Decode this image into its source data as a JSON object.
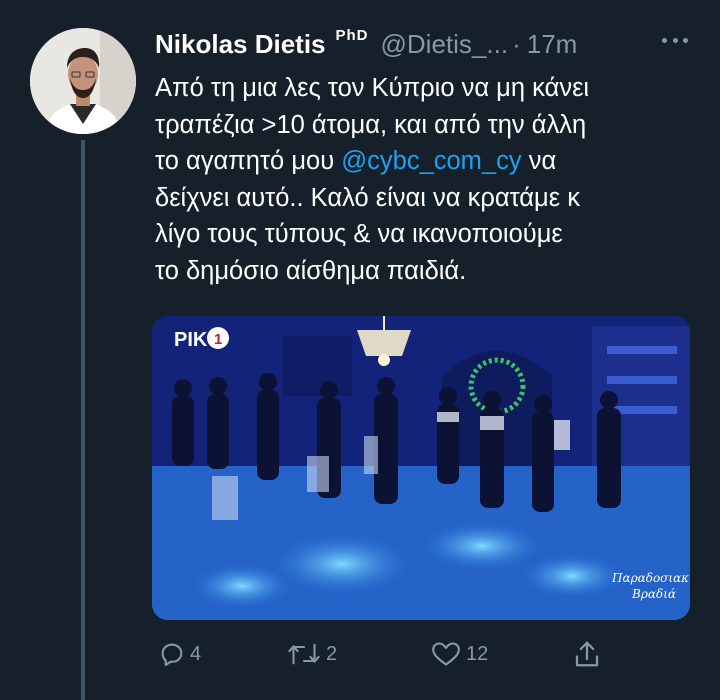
{
  "author": {
    "display_name": "Nikolas Dietis",
    "badge": "PhD",
    "handle": "@Dietis_...",
    "separator": "·",
    "time": "17m"
  },
  "tweet": {
    "lines": [
      "Από τη μια λες τον Κύπριο να μη κάνει",
      "τραπέζια >10 άτομα, και από την άλλη",
      "το αγαπητό μου",
      "δείχνει αυτό.. Καλό είναι να κρατάμε κ",
      "λίγο τους τύπους & να ικανοποιούμε",
      "το δημόσιο αίσθημα παιδιά."
    ],
    "mention": "@cybc_com_cy",
    "after_mention": "να"
  },
  "media": {
    "channel_logo": "ΡΙΚ",
    "channel_logo_digit": "1",
    "show_caption_line1": "Παραδοσιακή",
    "show_caption_line2": "Βραδιά"
  },
  "actions": {
    "replies": "4",
    "retweets": "2",
    "likes": "12"
  },
  "colors": {
    "background": "#15202b",
    "secondary_text": "#8899a6",
    "link": "#1da1f2"
  },
  "icons": [
    "more-icon",
    "reply-icon",
    "retweet-icon",
    "like-icon",
    "share-icon"
  ]
}
